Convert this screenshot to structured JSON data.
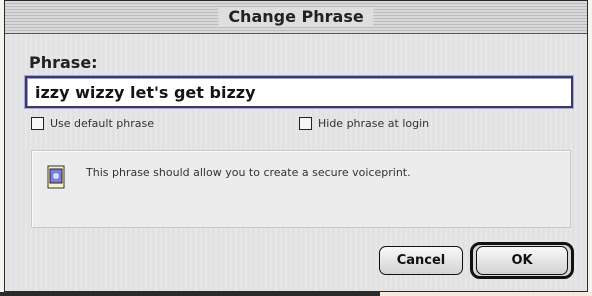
{
  "window": {
    "title": "Change Phrase"
  },
  "phrase": {
    "label": "Phrase:",
    "value": "izzy wizzy let's get bizzy"
  },
  "options": {
    "use_default_label": "Use default phrase",
    "hide_phrase_label": "Hide phrase at login"
  },
  "info": {
    "message": "This phrase should allow you to create a secure voiceprint."
  },
  "buttons": {
    "cancel_label": "Cancel",
    "ok_label": "OK"
  }
}
